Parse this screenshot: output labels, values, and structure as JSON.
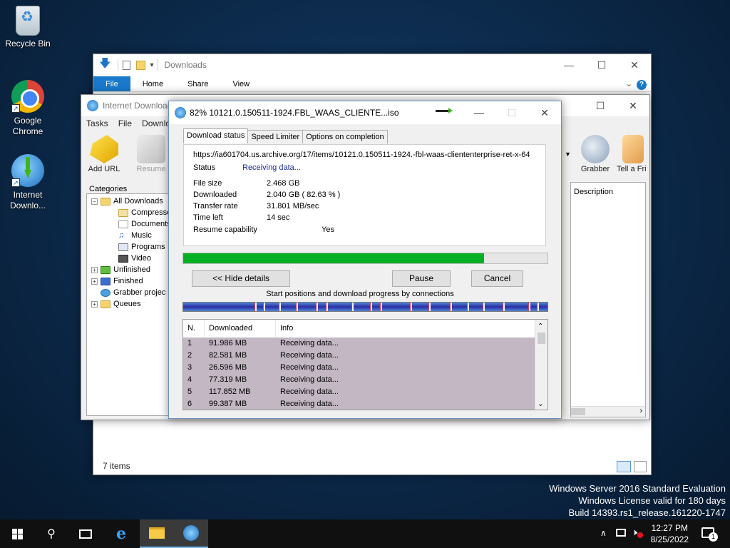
{
  "desktop": {
    "icons": [
      {
        "label": "Recycle Bin"
      },
      {
        "label": "Google Chrome"
      },
      {
        "label": "Internet Downlo..."
      }
    ],
    "watermark": [
      "Windows Server 2016 Standard Evaluation",
      "Windows License valid for 180 days",
      "Build 14393.rs1_release.161220-1747"
    ]
  },
  "explorer": {
    "title": "Downloads",
    "ribbon_tabs": [
      "File",
      "Home",
      "Share",
      "View"
    ],
    "status": "7 items"
  },
  "idm": {
    "title": "Internet Download",
    "menu": [
      "Tasks",
      "File",
      "Downlo"
    ],
    "toolbar": {
      "add_url": "Add URL",
      "resume": "Resume",
      "grabber": "Grabber",
      "tell_friend": "Tell a Fri"
    },
    "categories_label": "Categories",
    "tree": {
      "all": "All Downloads",
      "compressed": "Compresse",
      "documents": "Documents",
      "music": "Music",
      "programs": "Programs",
      "video": "Video",
      "unfinished": "Unfinished",
      "finished": "Finished",
      "grabber": "Grabber projec",
      "queues": "Queues"
    },
    "description_header": "Description"
  },
  "dialog": {
    "title": "82% 10121.0.150511-1924.FBL_WAAS_CLIENTE...iso",
    "tabs": [
      "Download status",
      "Speed Limiter",
      "Options on completion"
    ],
    "url": "https://ia601704.us.archive.org/17/items/10121.0.150511-1924.-fbl-waas-cliententerprise-ret-x-64",
    "status_label": "Status",
    "status_value": "Receiving data...",
    "file_size_label": "File size",
    "file_size_value": "2.468  GB",
    "downloaded_label": "Downloaded",
    "downloaded_value": "2.040  GB  ( 82.63 % )",
    "transfer_rate_label": "Transfer rate",
    "transfer_rate_value": "31.801  MB/sec",
    "time_left_label": "Time left",
    "time_left_value": "14 sec",
    "resume_label": "Resume capability",
    "resume_value": "Yes",
    "progress": 0.8263,
    "hide_details": "<< Hide details",
    "pause": "Pause",
    "cancel": "Cancel",
    "connections_caption": "Start positions and download progress by connections",
    "table_headers": [
      "N.",
      "Downloaded",
      "Info"
    ],
    "rows": [
      {
        "n": "1",
        "downloaded": "91.986  MB",
        "info": "Receiving data..."
      },
      {
        "n": "2",
        "downloaded": "82.581  MB",
        "info": "Receiving data..."
      },
      {
        "n": "3",
        "downloaded": "26.596  MB",
        "info": "Receiving data..."
      },
      {
        "n": "4",
        "downloaded": "77.319  MB",
        "info": "Receiving data..."
      },
      {
        "n": "5",
        "downloaded": "117.852  MB",
        "info": "Receiving data..."
      },
      {
        "n": "6",
        "downloaded": "99.387  MB",
        "info": "Receiving data..."
      }
    ]
  },
  "taskbar": {
    "time": "12:27 PM",
    "date": "8/25/2022",
    "notification_count": "1"
  }
}
